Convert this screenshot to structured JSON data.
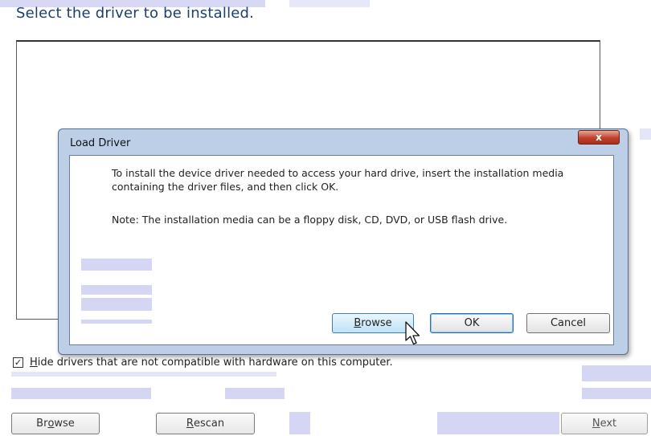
{
  "page": {
    "heading": "Select the driver to be installed."
  },
  "dialog": {
    "title": "Load Driver",
    "close_glyph": "x",
    "message": "To install the device driver needed to access your hard drive, insert the installation media containing the driver files, and then click OK.",
    "note": "Note: The installation media can be a floppy disk, CD, DVD, or USB flash drive.",
    "buttons": {
      "browse": {
        "pre": "",
        "acc": "B",
        "post": "rowse"
      },
      "ok": "OK",
      "cancel": "Cancel"
    }
  },
  "wizard": {
    "hide_checkbox": {
      "checked": true,
      "mark": "✓",
      "acc": "H",
      "rest": "ide drivers that are not compatible with hardware on this computer."
    },
    "buttons": {
      "browse": {
        "pre": "Br",
        "acc": "o",
        "post": "wse"
      },
      "rescan": {
        "pre": "",
        "acc": "R",
        "post": "escan"
      },
      "next": {
        "pre": "",
        "acc": "N",
        "post": "ext",
        "enabled": false
      }
    }
  },
  "icons": {
    "cursor": "arrow-pointer-icon",
    "close": "close-icon",
    "checkmark": "checkmark-icon"
  },
  "colors": {
    "heading": "#1d3e6f",
    "dialog_frame": "#bccfe7",
    "close_button": "#c0402a",
    "focus_border": "#2c6fb7"
  }
}
